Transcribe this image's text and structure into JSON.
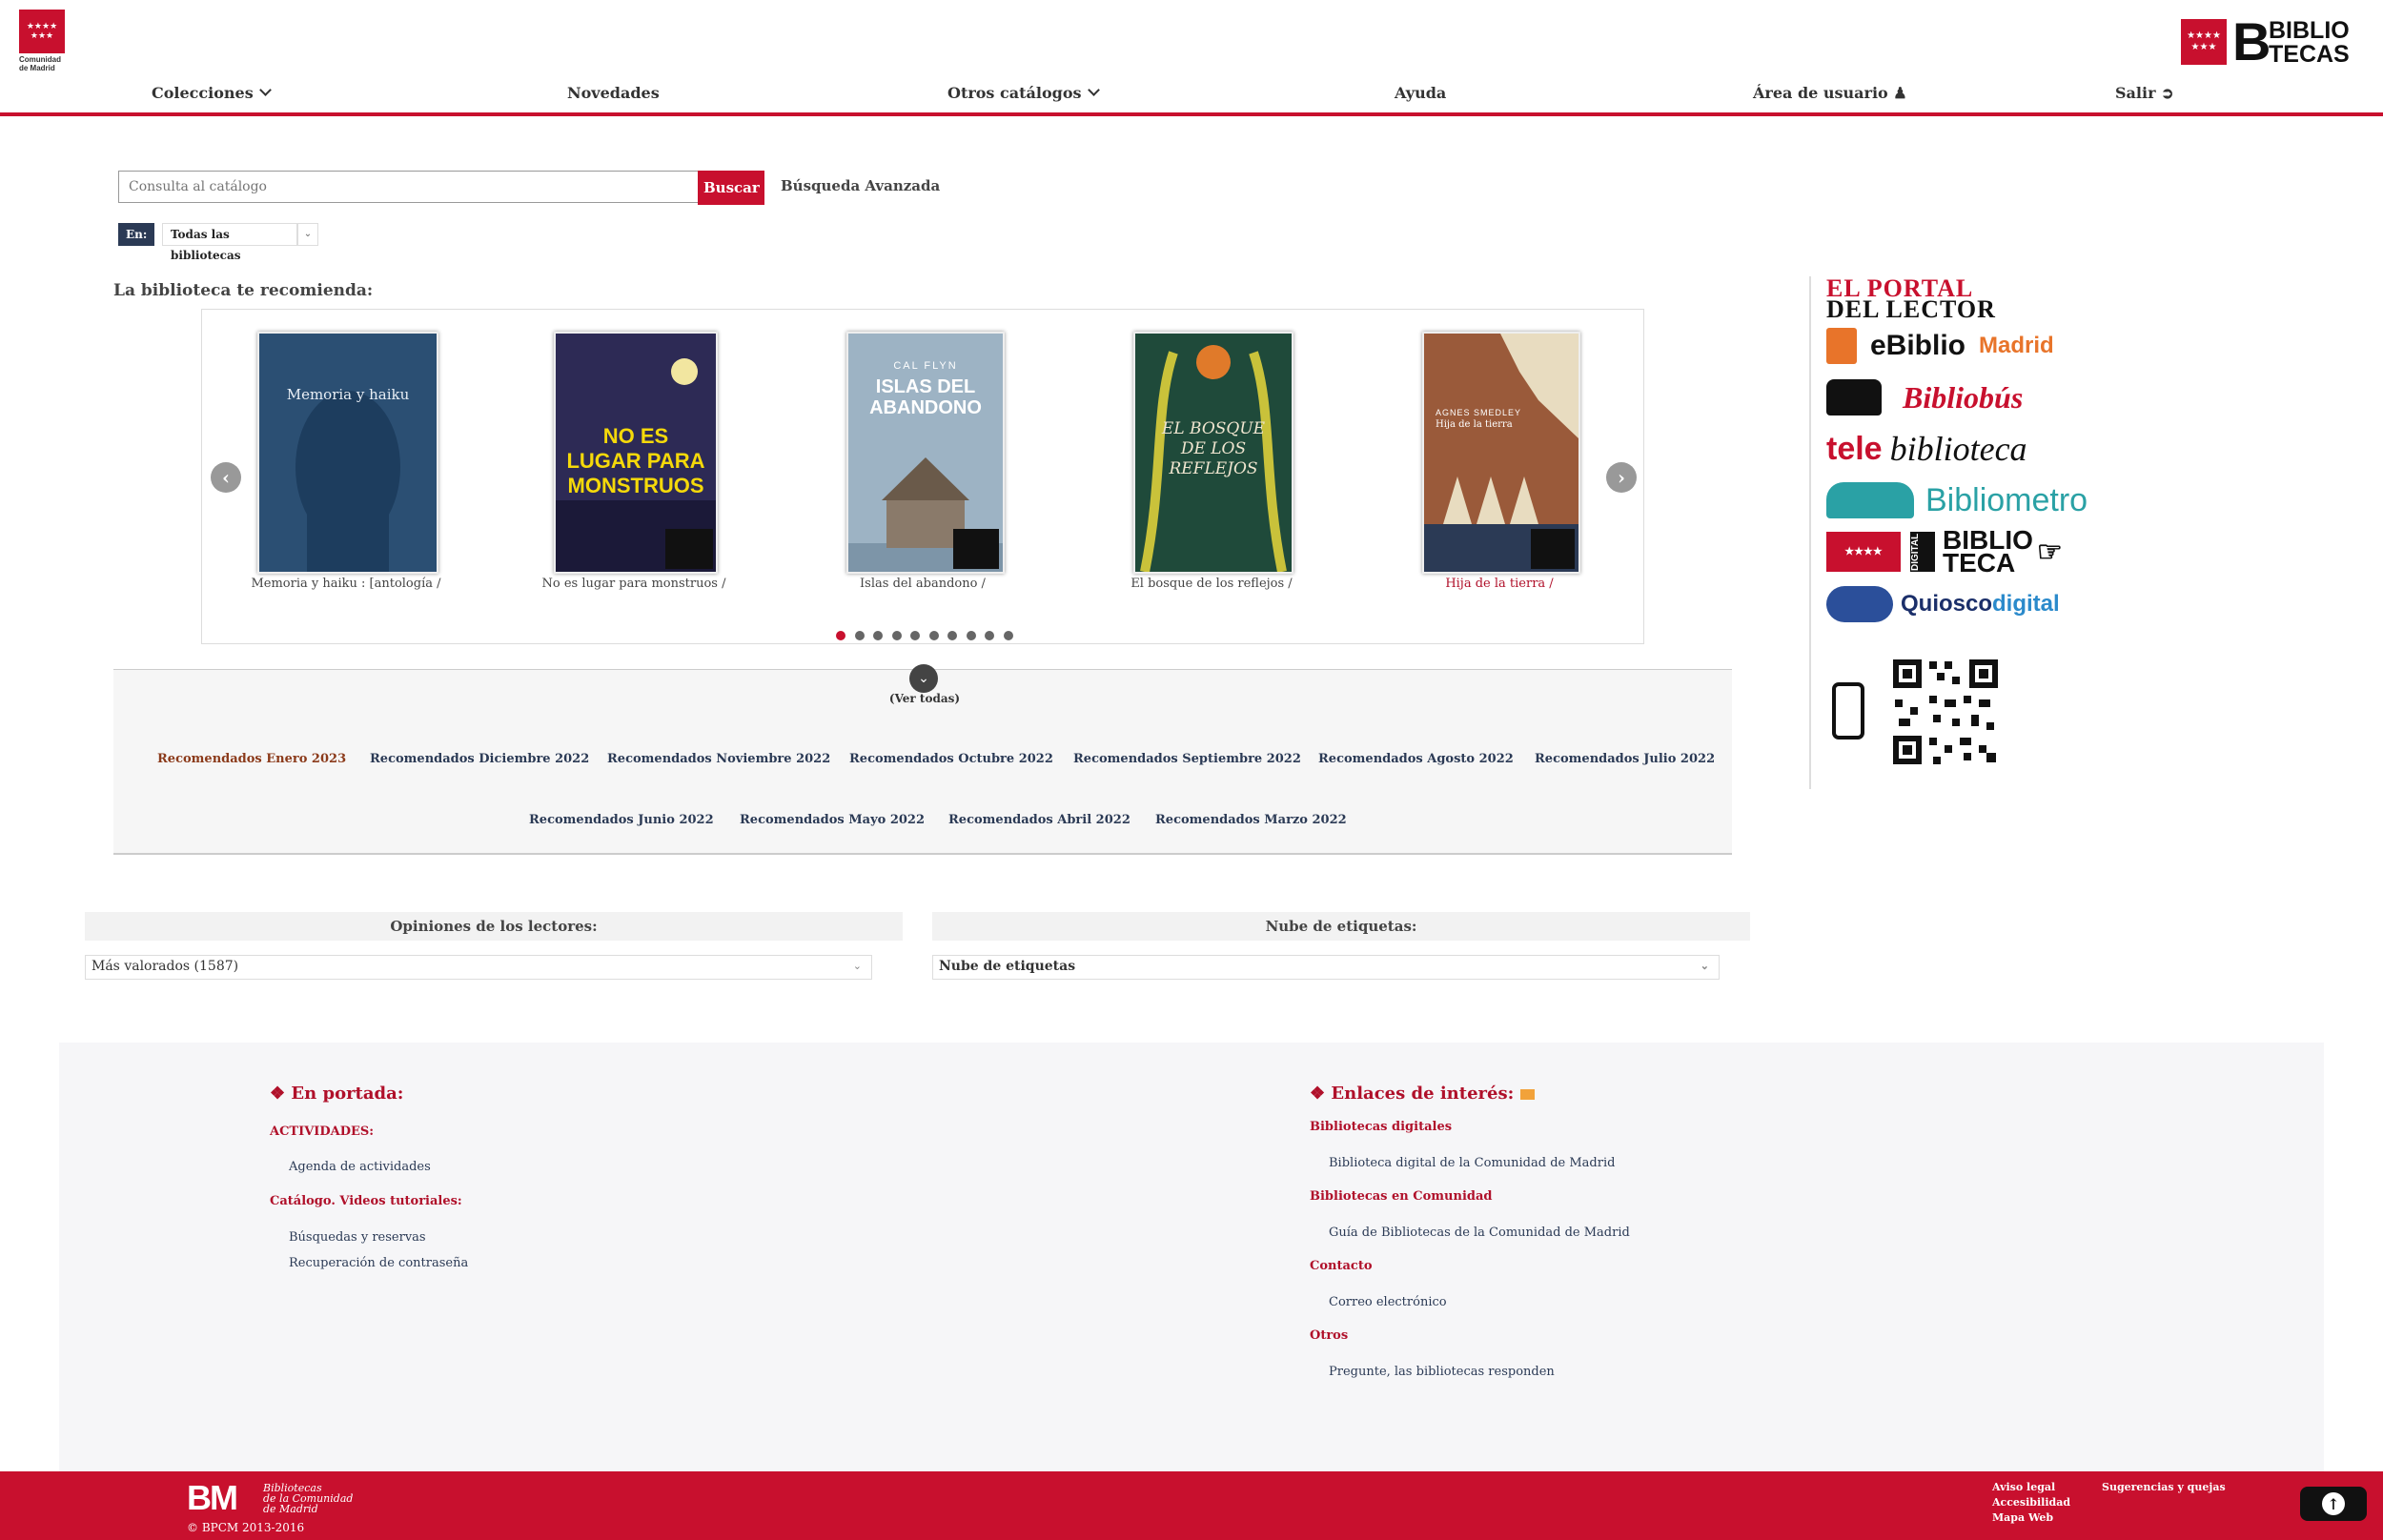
{
  "header": {
    "logo_left_text": [
      "Comunidad",
      "de Madrid"
    ],
    "logo_right_text": [
      "BIBLIO",
      "TECAS"
    ],
    "nav": [
      {
        "label": "Colecciones",
        "has_dropdown": true
      },
      {
        "label": "Novedades"
      },
      {
        "label": "Otros catálogos",
        "has_dropdown": true
      },
      {
        "label": "Ayuda"
      },
      {
        "label": "Área de usuario",
        "icon": "user-icon"
      },
      {
        "label": "Salir",
        "icon": "exit-icon"
      }
    ]
  },
  "search": {
    "placeholder": "Consulta al catálogo",
    "button_label": "Buscar",
    "advanced_label": "Búsqueda Avanzada",
    "scope_label": "En:",
    "scope_value": "Todas las bibliotecas"
  },
  "recommend": {
    "title": "La biblioteca te recomienda:",
    "books": [
      {
        "caption": "Memoria y haiku : [antología /",
        "cover_title": "Memoria y haiku",
        "cover_color": "#2b4f73"
      },
      {
        "caption": "No es lugar para monstruos /",
        "cover_title": "NO ES LUGAR PARA MONSTRUOS",
        "cover_color": "#2d2a55"
      },
      {
        "caption": "Islas del abandono /",
        "cover_title": "ISLAS DEL ABANDONO",
        "cover_author": "CAL FLYN",
        "cover_color": "#9db3c4"
      },
      {
        "caption": "El bosque de los reflejos /",
        "cover_title": "EL BOSQUE DE LOS REFLEJOS",
        "cover_color": "#1f4a3a"
      },
      {
        "caption": "Hija de la tierra /",
        "cover_title": "Hija de la tierra",
        "cover_author": "AGNES SMEDLEY",
        "cover_color": "#9a5a3a"
      }
    ],
    "pager_count": 10,
    "pager_active": 0,
    "see_all": "(Ver todas)"
  },
  "months": {
    "row1": [
      "Recomendados Enero 2023",
      "Recomendados Diciembre 2022",
      "Recomendados Noviembre 2022",
      "Recomendados Octubre 2022",
      "Recomendados Septiembre 2022",
      "Recomendados Agosto 2022",
      "Recomendados Julio 2022"
    ],
    "row2": [
      "Recomendados Junio 2022",
      "Recomendados Mayo 2022",
      "Recomendados Abril 2022",
      "Recomendados Marzo 2022"
    ]
  },
  "opinions": {
    "title": "Opiniones de los lectores:",
    "selected": "Más valorados (1587)"
  },
  "tags": {
    "title": "Nube de etiquetas:",
    "selected": "Nube de etiquetas"
  },
  "portada": {
    "title": "En portada:",
    "sections": [
      {
        "label": "ACTIVIDADES:",
        "links": [
          "Agenda de actividades"
        ]
      },
      {
        "label": "Catálogo. Videos tutoriales:",
        "links": [
          "Búsquedas y reservas",
          "Recuperación de contraseña"
        ]
      }
    ]
  },
  "enlaces": {
    "title": "Enlaces de interés:",
    "sections": [
      {
        "label": "Bibliotecas digitales",
        "links": [
          "Biblioteca digital de la Comunidad de Madrid"
        ]
      },
      {
        "label": "Bibliotecas en Comunidad",
        "links": [
          "Guía de Bibliotecas de la Comunidad de Madrid"
        ]
      },
      {
        "label": "Contacto",
        "links": [
          "Correo electrónico"
        ]
      },
      {
        "label": "Otros",
        "links": [
          "Pregunte, las bibliotecas responden"
        ]
      }
    ]
  },
  "promos": {
    "portal": [
      "EL PORTAL",
      "DEL LECTOR"
    ],
    "ebiblio": [
      "eBiblio",
      "Madrid"
    ],
    "bibliobus": "Bibliobús",
    "telebiblioteca": [
      "tele",
      "biblioteca"
    ],
    "bibliometro": "Bibliometro",
    "digital": [
      "BIBLIO",
      "TECA",
      "DIGITAL"
    ],
    "quiosco": [
      "Quiosco",
      "digital"
    ]
  },
  "footer": {
    "logo_text": [
      "Bibliotecas",
      "de la Comunidad",
      "de Madrid"
    ],
    "copyright": "© BPCM 2013-2016",
    "links_col1": [
      "Aviso legal",
      "Accesibilidad",
      "Mapa Web"
    ],
    "links_col2": [
      "Sugerencias y quejas"
    ]
  },
  "colors": {
    "brand_red": "#c8102e",
    "navy": "#2b3a55"
  }
}
